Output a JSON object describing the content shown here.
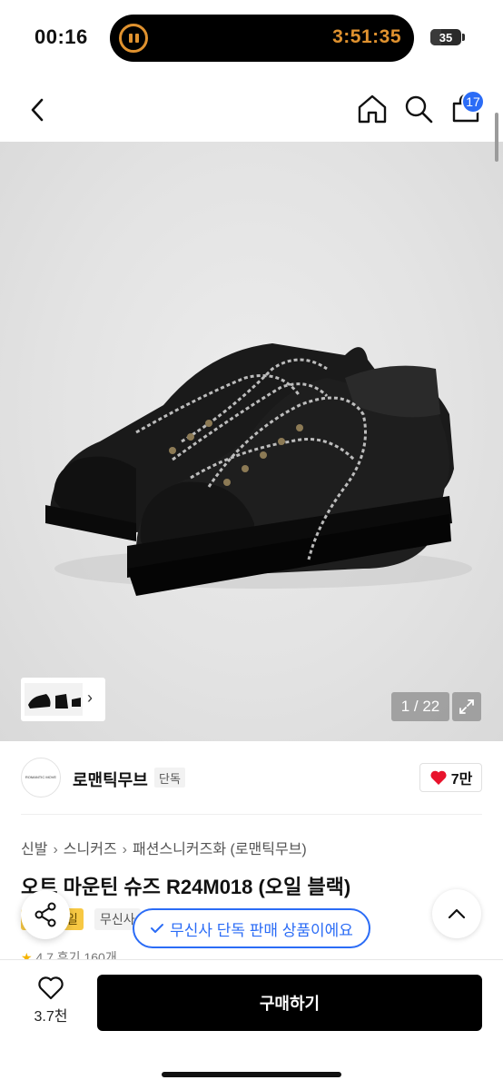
{
  "status_bar": {
    "time": "00:16",
    "timer": "3:51:35",
    "battery": "35"
  },
  "nav": {
    "cart_count": "17"
  },
  "gallery": {
    "page_counter": "1 / 22"
  },
  "brand": {
    "logo_text": "ROMANTIC MOVE",
    "name": "로맨틱무브",
    "tag": "단독",
    "likes": "7만"
  },
  "breadcrumb": {
    "items": [
      "신발",
      "스니커즈",
      "패션스니커즈화",
      "(로맨틱무브)"
    ]
  },
  "product": {
    "title": "오트 마운틴 슈즈 R24M018 (오일 블랙)",
    "badge_partial": "일",
    "badge_muse_partial": "무신사",
    "rating_partial": "4.7 후기 160개"
  },
  "toast": {
    "text": "무신사 단독 판매 상품이에요"
  },
  "bottom_bar": {
    "wish_count": "3.7천",
    "buy_label": "구매하기"
  },
  "colors": {
    "accent_blue": "#2b6cf6",
    "like_red": "#e8132c",
    "timer_orange": "#e0922f"
  }
}
